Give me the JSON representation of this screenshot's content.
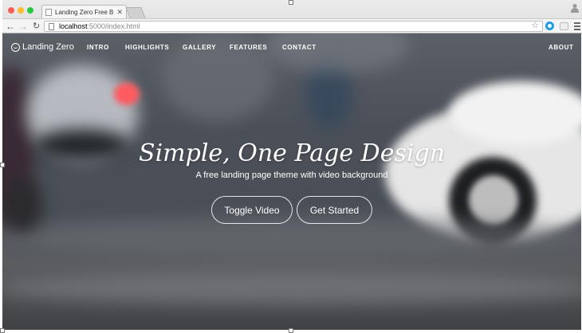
{
  "browser": {
    "tab_title": "Landing Zero Free Bootstr",
    "url_host": "localhost",
    "url_path": ":5000/index.html"
  },
  "site": {
    "logo_text": "Landing Zero",
    "nav": [
      {
        "label": "INTRO"
      },
      {
        "label": "HIGHLIGHTS"
      },
      {
        "label": "GALLERY"
      },
      {
        "label": "FEATURES"
      },
      {
        "label": "CONTACT"
      }
    ],
    "nav_right": "ABOUT"
  },
  "hero": {
    "title": "Simple, One Page Design",
    "subtitle": "A free landing page theme with video background",
    "buttons": {
      "toggle_video": "Toggle Video",
      "get_started": "Get Started"
    }
  },
  "colors": {
    "accent_red": "#ff5a5f",
    "text": "#ffffff"
  },
  "icons": [
    "close-icon",
    "search-icon",
    "star-icon",
    "menu-icon",
    "logo-icon"
  ]
}
